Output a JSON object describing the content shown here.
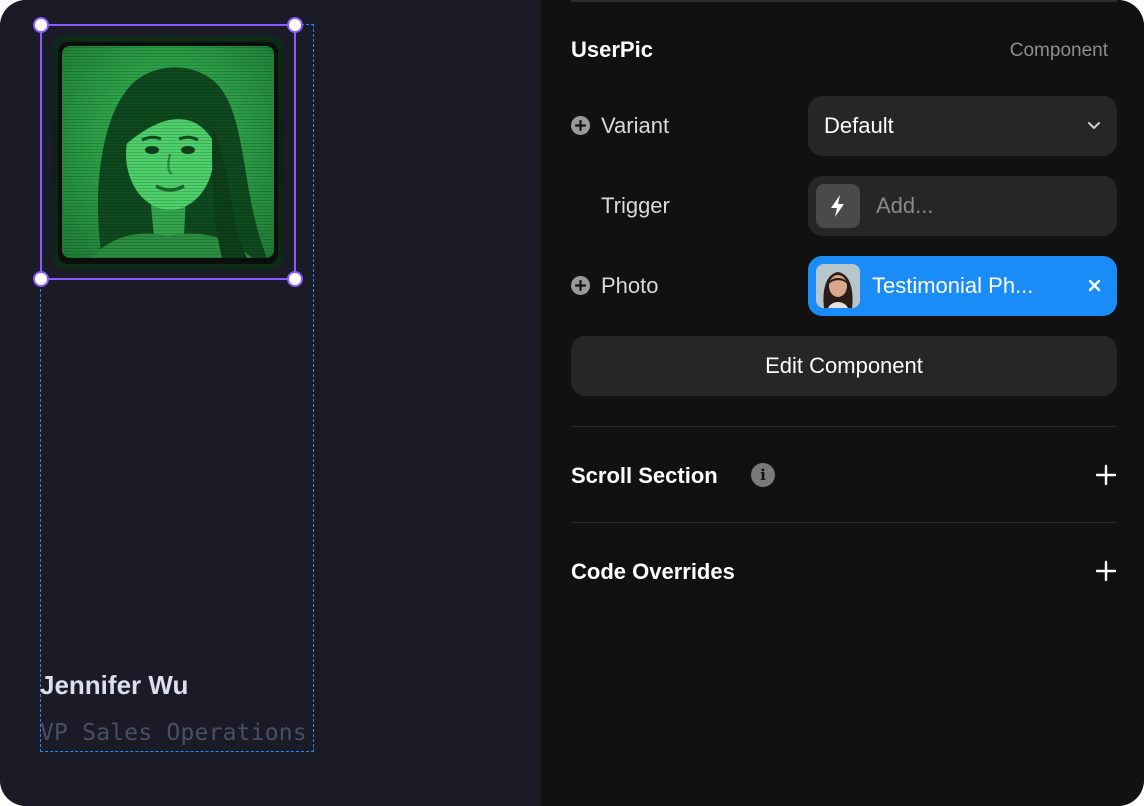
{
  "canvas": {
    "person_name": "Jennifer Wu",
    "person_title": "VP Sales Operations"
  },
  "panel": {
    "component_name": "UserPic",
    "component_type": "Component",
    "variant": {
      "label": "Variant",
      "value": "Default",
      "icon": "chevron-down-icon"
    },
    "trigger": {
      "label": "Trigger",
      "placeholder": "Add...",
      "icon": "lightning-bolt-icon"
    },
    "photo": {
      "label": "Photo",
      "value": "Testimonial Ph...",
      "icon": "close-icon"
    },
    "edit_button": "Edit Component",
    "scroll_section": {
      "label": "Scroll Section",
      "icon": "info-icon"
    },
    "code_overrides": {
      "label": "Code Overrides"
    }
  },
  "colors": {
    "accent_selection": "#8a5cff",
    "frame_outline": "#1f8cff",
    "chip_blue": "#1a8cf7",
    "photo_tint": "#2a9a44"
  }
}
